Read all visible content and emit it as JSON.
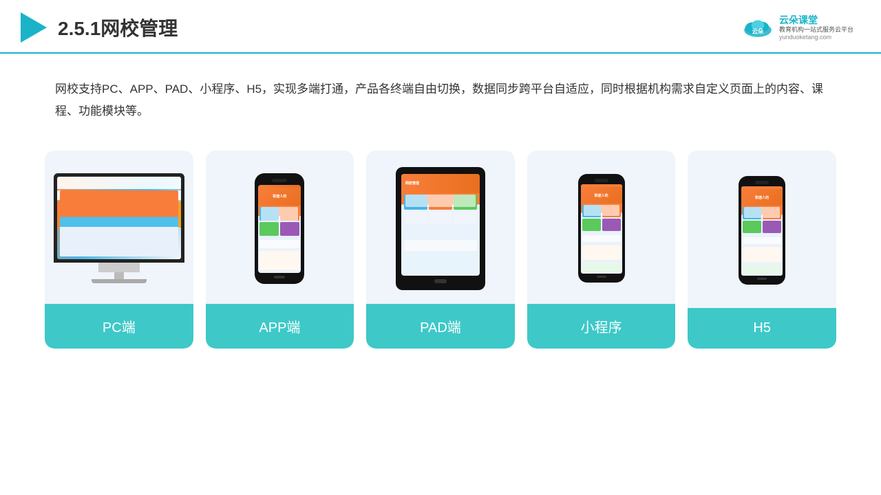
{
  "header": {
    "title": "2.5.1网校管理",
    "brand_name": "云朵课堂",
    "brand_sub": "教育机构一站\n式服务云平台",
    "brand_url": "yunduoketang.com"
  },
  "description": {
    "text": "网校支持PC、APP、PAD、小程序、H5，实现多端打通，产品各终端自由切换，数据同步跨平台自适应，同时根据机构需求自定义页面上的内容、课程、功能模块等。"
  },
  "cards": [
    {
      "id": "pc",
      "label": "PC端"
    },
    {
      "id": "app",
      "label": "APP端"
    },
    {
      "id": "pad",
      "label": "PAD端"
    },
    {
      "id": "miniprogram",
      "label": "小程序"
    },
    {
      "id": "h5",
      "label": "H5"
    }
  ],
  "colors": {
    "teal": "#3ec8c8",
    "accent": "#1ab3c8",
    "bg_card": "#eef2fa"
  }
}
